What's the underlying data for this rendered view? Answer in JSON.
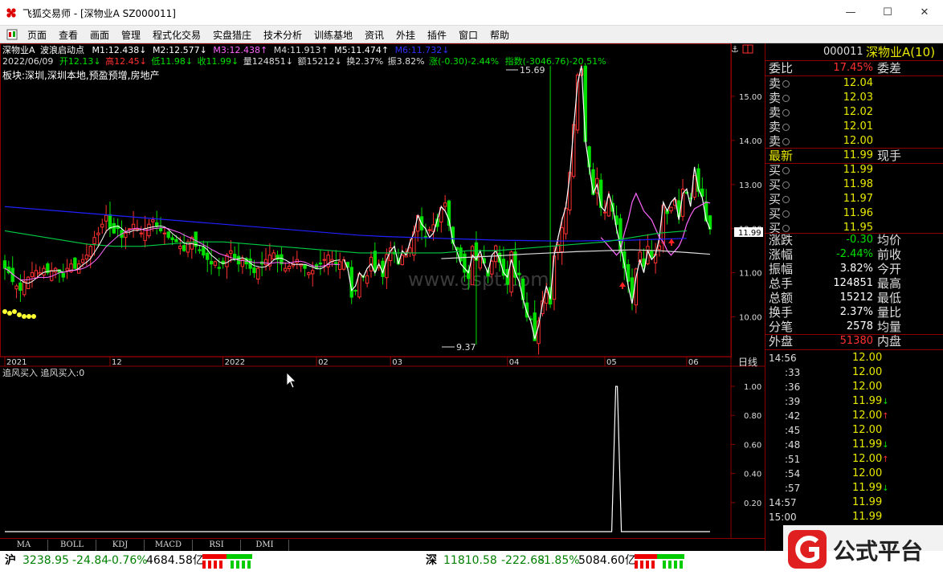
{
  "window": {
    "title": "飞狐交易师 - [深物业A SZ000011]",
    "minimize": "—",
    "maximize": "☐",
    "close": "✕"
  },
  "menu": [
    "页面",
    "查看",
    "画面",
    "管理",
    "程式化交易",
    "实盘猎庄",
    "技术分析",
    "训练基地",
    "资讯",
    "外挂",
    "插件",
    "窗口",
    "帮助"
  ],
  "info": {
    "line1": {
      "name": "深物业A",
      "indicator": "波浪启动点",
      "m1": "M1:12.438↓",
      "m2": "M2:12.577↓",
      "m3": "M3:12.438↑",
      "m4": "M4:11.913↑",
      "m5": "M5:11.474↑",
      "m6": "M6:11.732↓"
    },
    "line2": {
      "date": "2022/06/09",
      "open": "开12.13↓",
      "high": "高12.45↓",
      "low": "低11.98↓",
      "close": "收11.99↓",
      "vol": "量124851↓",
      "amount": "额15212↓",
      "turnover": "换2.37%",
      "amplitude": "振3.82%",
      "change": "涨(-0.30)-2.44%",
      "index": "指数(-3046.76)-20.51%"
    },
    "line3": "板块:深圳,深圳本地,预盈预增,房地产"
  },
  "chart_labels": {
    "high_label": "15.69",
    "low_label": "9.37",
    "price_tag": "11.99",
    "period": "日线",
    "watermark": "www.gspt.com",
    "anchor_icon": "⚓",
    "sub_title": "追风买入  追风买入:0"
  },
  "chart_data": [
    {
      "type": "line",
      "panel": "price",
      "y_ticks": [
        15.0,
        14.0,
        13.0,
        12.0,
        11.0,
        10.0
      ],
      "y_tick_labels": [
        "15.00",
        "14.00",
        "13.00",
        "12.00",
        "11.00",
        "10.00"
      ],
      "ylim": [
        9.1,
        16.2
      ],
      "x_tick_labels": [
        "2021",
        "12",
        "2022",
        "02",
        "03",
        "04",
        "05",
        "06"
      ],
      "x_tick_index": [
        0,
        27,
        56,
        80,
        99,
        129,
        154,
        175
      ],
      "n_bars": 182,
      "last_close": 11.99,
      "high": 15.69,
      "low": 9.37,
      "series": [
        {
          "color": "#ffffff",
          "values": [
            11.3,
            11.1,
            10.6,
            10.7,
            11.0,
            10.9,
            11.1,
            11.2,
            11.0,
            11.2,
            11.0,
            11.3,
            11.5,
            11.6,
            11.2,
            11.5,
            11.4,
            11.7,
            11.9,
            12.3,
            12.1,
            12.0,
            11.8,
            11.9,
            12.2,
            12.5,
            12.4,
            12.2,
            11.7,
            11.5,
            11.2,
            11.1,
            11.0,
            11.4,
            11.3,
            11.5,
            11.2,
            11.0,
            11.4,
            11.5,
            11.3,
            11.0,
            10.9,
            11.3,
            11.0,
            10.8,
            10.4,
            10.1,
            9.9,
            9.5,
            9.8,
            10.3,
            10.7,
            10.4,
            11.4,
            11.8,
            12.2,
            12.5,
            13.2,
            14.3,
            15.3,
            15.69,
            14.0,
            13.4,
            12.8,
            13.0,
            12.5,
            12.4,
            12.8,
            12.5,
            12.0,
            11.6,
            11.2,
            10.7,
            10.3,
            10.9,
            11.3,
            11.0,
            11.5,
            11.3,
            11.4,
            11.8,
            12.6,
            12.4,
            12.6,
            12.7,
            12.2,
            12.8,
            12.9,
            12.5,
            13.4,
            12.9,
            12.7,
            12.2,
            11.99
          ],
          "x_index_offset": 87
        },
        {
          "color": "#ff66ff",
          "values": [
            11.8,
            11.7,
            11.6,
            11.5,
            11.4,
            11.5,
            11.9,
            12.2,
            12.6,
            12.8,
            12.6,
            12.4,
            12.3,
            12.2,
            12.0,
            11.8,
            11.7,
            11.5,
            11.4,
            11.5,
            11.6,
            11.8,
            12.1,
            12.3,
            12.45,
            12.5,
            12.55,
            12.6,
            12.58
          ],
          "x_index_offset": 153
        },
        {
          "color": "#2020ff",
          "values": [
            12.5,
            12.45,
            12.4,
            12.35,
            12.3,
            12.25,
            12.2,
            12.15,
            12.1,
            12.05,
            12.0,
            11.95,
            11.9,
            11.85,
            11.82,
            11.8,
            11.78,
            11.76,
            11.74,
            11.73,
            11.72,
            11.72,
            11.73,
            11.74,
            11.76,
            11.78
          ],
          "x_index_offset": 0,
          "step": 7
        },
        {
          "color": "#00cc44",
          "values": [
            11.95,
            11.85,
            11.75,
            11.65,
            11.6,
            11.6,
            11.65,
            11.7,
            11.7,
            11.65,
            11.6,
            11.55,
            11.5,
            11.45,
            11.45,
            11.45,
            11.45,
            11.5,
            11.5,
            11.55,
            11.6,
            11.65,
            11.7,
            11.8,
            11.9,
            11.95
          ],
          "x_index_offset": 0,
          "step": 7
        },
        {
          "color": "#dddddd",
          "values": [
            11.32,
            11.35,
            11.38,
            11.42,
            11.45,
            11.48,
            11.5,
            11.52,
            11.5,
            11.46,
            11.42
          ],
          "x_index_offset": 112,
          "step": 7
        }
      ]
    },
    {
      "type": "line",
      "panel": "sub",
      "name": "追风买入",
      "y_tick_labels": [
        "1.00",
        "0.80",
        "0.60",
        "0.40",
        "0.20"
      ],
      "y_ticks": [
        1.0,
        0.8,
        0.6,
        0.4,
        0.2
      ],
      "ylim": [
        0,
        1.05
      ],
      "spike_index": 157,
      "spike_value": 1.0
    }
  ],
  "quote": {
    "code": "000011",
    "name": "深物业A(10)",
    "webi_label": "委比",
    "webi_value": "17.45%",
    "weicha_label": "委差",
    "sells": [
      {
        "label": "卖",
        "price": "12.04"
      },
      {
        "label": "卖",
        "price": "12.03"
      },
      {
        "label": "卖",
        "price": "12.02"
      },
      {
        "label": "卖",
        "price": "12.01"
      },
      {
        "label": "卖",
        "price": "12.00"
      }
    ],
    "latest_label": "最新",
    "latest_value": "11.99",
    "xianshou_label": "现手",
    "buys": [
      {
        "label": "买",
        "price": "11.99"
      },
      {
        "label": "买",
        "price": "11.98"
      },
      {
        "label": "买",
        "price": "11.97"
      },
      {
        "label": "买",
        "price": "11.96"
      },
      {
        "label": "买",
        "price": "11.95"
      }
    ],
    "stats": [
      {
        "label": "涨跌",
        "value": "-0.30",
        "label2": "均价",
        "color": "#00e000"
      },
      {
        "label": "涨幅",
        "value": "-2.44%",
        "label2": "前收",
        "color": "#00e000"
      },
      {
        "label": "振幅",
        "value": "3.82%",
        "label2": "今开",
        "color": "#ffffff"
      },
      {
        "label": "总手",
        "value": "124851",
        "label2": "最高",
        "color": "#ffffff"
      },
      {
        "label": "总额",
        "value": "15212",
        "label2": "最低",
        "color": "#ffffff"
      },
      {
        "label": "换手",
        "value": "2.37%",
        "label2": "量比",
        "color": "#ffffff"
      },
      {
        "label": "分笔",
        "value": "2578",
        "label2": "均量",
        "color": "#ffffff"
      }
    ],
    "waipan_label": "外盘",
    "waipan_value": "51380",
    "neipan_label": "内盘",
    "ticks": [
      {
        "time": "14:56",
        "price": "12.00",
        "arrow": ""
      },
      {
        "time": ":33",
        "price": "12.00",
        "arrow": ""
      },
      {
        "time": ":36",
        "price": "12.00",
        "arrow": ""
      },
      {
        "time": ":39",
        "price": "11.99",
        "arrow": "↓"
      },
      {
        "time": ":42",
        "price": "12.00",
        "arrow": "↑"
      },
      {
        "time": ":45",
        "price": "12.00",
        "arrow": ""
      },
      {
        "time": ":48",
        "price": "11.99",
        "arrow": "↓"
      },
      {
        "time": ":51",
        "price": "12.00",
        "arrow": "↑"
      },
      {
        "time": ":54",
        "price": "12.00",
        "arrow": ""
      },
      {
        "time": ":57",
        "price": "11.99",
        "arrow": "↓"
      },
      {
        "time": "14:57",
        "price": "11.99",
        "arrow": ""
      },
      {
        "time": "15:00",
        "price": "11.99",
        "arrow": ""
      }
    ]
  },
  "tabs": [
    "MA",
    "BOLL",
    "KDJ",
    "MACD",
    "RSI",
    "DMI"
  ],
  "status": {
    "sh_label": "沪",
    "sh_index": "3238.95",
    "sh_change": "-24.84",
    "sh_pct": "-0.76%",
    "sh_amount": "4684.58亿",
    "sz_label": "深",
    "sz_index": "11810.58",
    "sz_change": "-222.68",
    "sz_pct": "-1.85%",
    "sz_amount": "5084.60亿"
  },
  "watermark_logo": {
    "text": "公式平台"
  },
  "colors": {
    "up": "#ff3030",
    "down": "#00e000",
    "price": "#e8e800",
    "panel_border": "#8b0000"
  }
}
